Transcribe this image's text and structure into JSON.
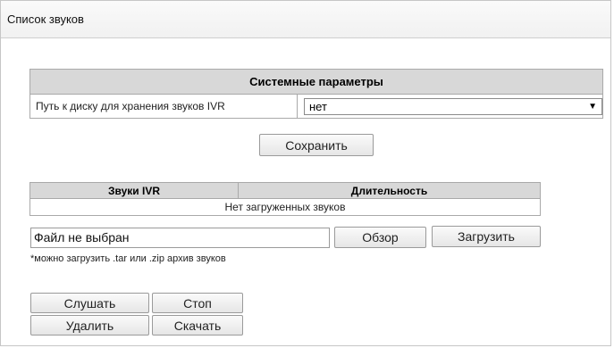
{
  "panel": {
    "title": "Список звуков"
  },
  "system": {
    "header": "Системные параметры",
    "path_label": "Путь к диску для хранения звуков IVR",
    "path_value": "нет",
    "save_label": "Сохранить"
  },
  "ivr": {
    "col_sound": "Звуки IVR",
    "col_duration": "Длительность",
    "empty_text": "Нет загруженных звуков",
    "file_text": "Файл не выбран",
    "browse_label": "Обзор",
    "upload_label": "Загрузить",
    "note": "*можно загрузить .tar или .zip архив звуков"
  },
  "actions": {
    "listen": "Слушать",
    "stop": "Стоп",
    "delete": "Удалить",
    "download": "Скачать"
  }
}
